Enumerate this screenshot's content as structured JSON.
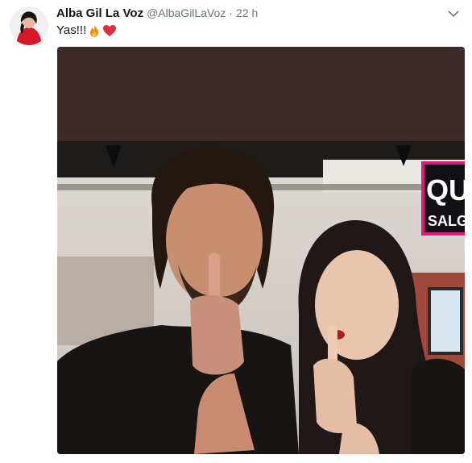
{
  "tweet": {
    "display_name": "Alba Gil La Voz",
    "handle": "@AlbaGilLaVoz",
    "separator": "·",
    "timestamp": "22 h",
    "text": "Yas!!!",
    "emojis": [
      "fire-emoji",
      "red-heart-emoji"
    ]
  },
  "icons": {
    "caret": "chevron-down-icon"
  },
  "media": {
    "sign_text_top": "QU",
    "sign_text_bottom": "SALGA"
  },
  "colors": {
    "name": "#14171a",
    "secondary": "#657786",
    "media_top": "#3d2b2a",
    "heart": "#e0245e",
    "fire": "#f4900c"
  }
}
